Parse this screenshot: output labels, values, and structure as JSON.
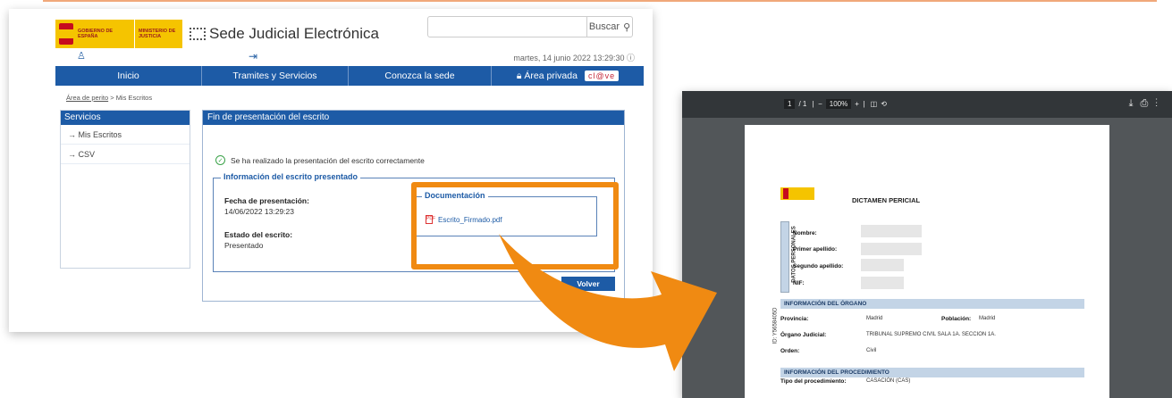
{
  "portal": {
    "gov1": "GOBIERNO DE ESPAÑA",
    "gov2": "MINISTERIO DE JUSTICIA",
    "site_title": "Sede Judicial Electrónica",
    "search_label": "Buscar",
    "datetime": "martes, 14 junio 2022   13:29:30",
    "nav": [
      "Inicio",
      "Tramites y Servicios",
      "Conozca la sede",
      "Área privada"
    ],
    "clave": "cl@ve",
    "breadcrumb": {
      "link": "Área de perito",
      "current": "Mis Escritos"
    },
    "sidebar": {
      "title": "Servicios",
      "items": [
        "Mis Escritos",
        "CSV"
      ]
    },
    "panel": {
      "title": "Fin de presentación del escrito",
      "success": "Se ha realizado la presentación del escrito correctamente",
      "legend": "Información del escrito presentado",
      "date_label": "Fecha de presentación:",
      "date_value": "14/06/2022 13:29:23",
      "status_label": "Estado del escrito:",
      "status_value": "Presentado",
      "doc_legend": "Documentación",
      "doc_file": "Escrito_Firmado.pdf",
      "back": "Volver"
    }
  },
  "viewer": {
    "page": "1",
    "pages": "/ 1",
    "zoom": "100%",
    "doc_title": "DICTAMEN PERICIAL",
    "vertical_section": "DATOS PERSONALES",
    "fields": [
      "Nombre:",
      "Primer apellido:",
      "Segundo apellido:",
      "NIF:"
    ],
    "section1": "INFORMACIÓN DEL ÓRGANO",
    "provincia_label": "Provincia:",
    "provincia": "Madrid",
    "poblacion_label": "Población:",
    "poblacion": "Madrid",
    "organo_label": "Órgano Judicial:",
    "organo": "TRIBUNAL SUPREMO CIVIL SALA 1A. SECCION 1A.",
    "orden_label": "Orden:",
    "orden": "Civil",
    "section2": "INFORMACIÓN DEL PROCEDIMIENTO",
    "tipo_label": "Tipo del procedimiento:",
    "tipo": "CASACIÓN (CAS)",
    "side_code": "ID: Y5658405D"
  },
  "colors": {
    "accent": "#1d5ba6",
    "highlight": "#f08a12"
  }
}
